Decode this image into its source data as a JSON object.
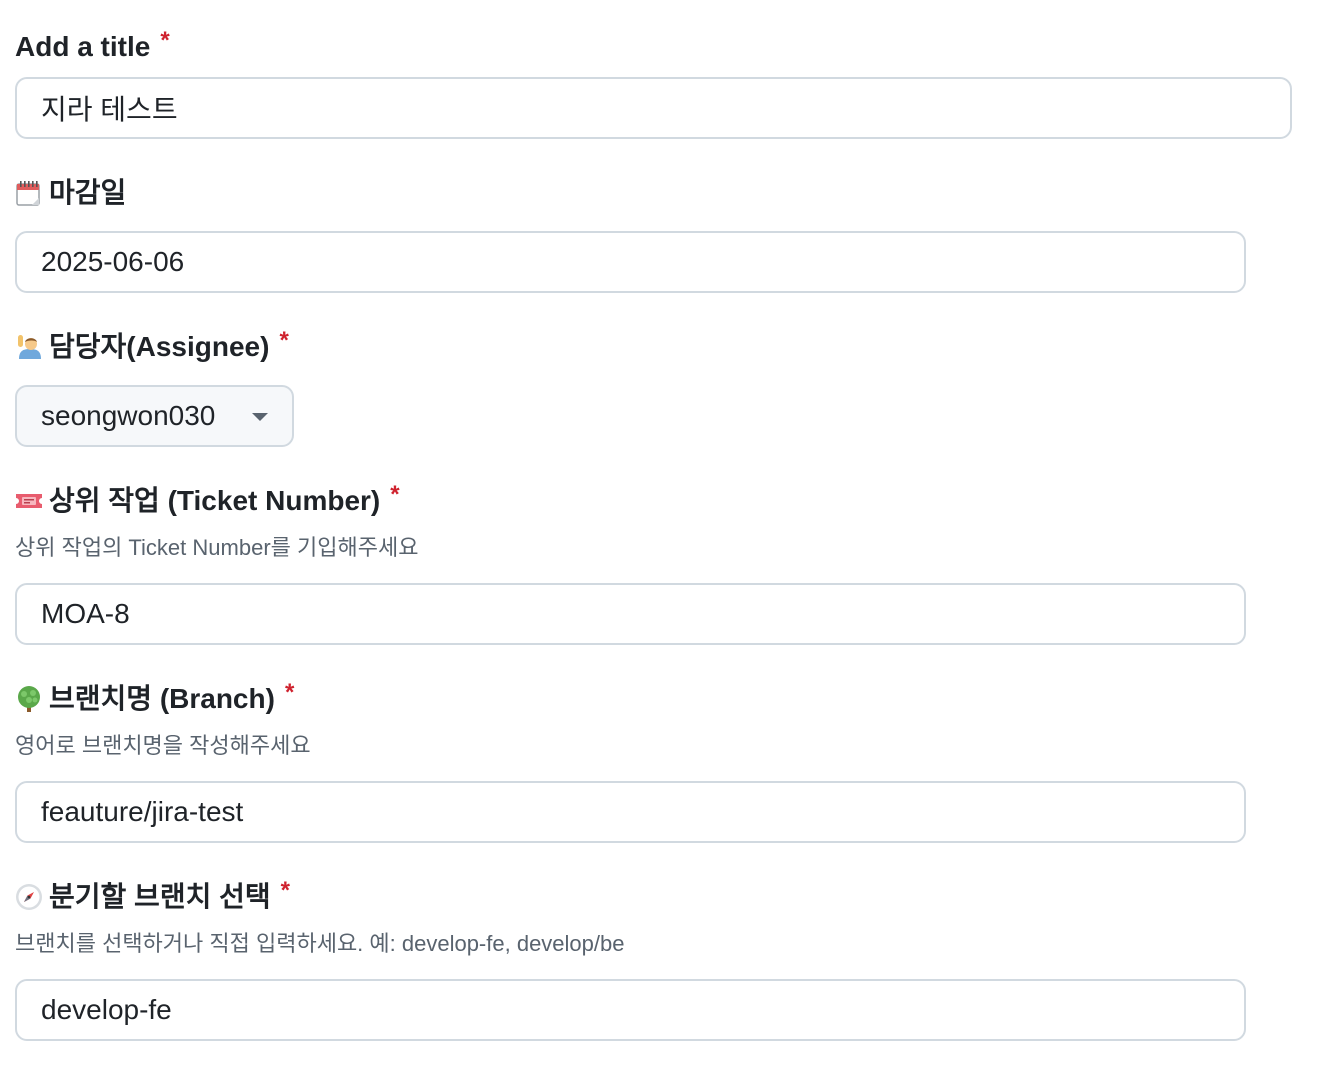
{
  "fields": {
    "title": {
      "label": "Add a title",
      "required_mark": "*",
      "value": "지라 테스트"
    },
    "due_date": {
      "icon": "calendar-icon",
      "label": "마감일",
      "value": "2025-06-06"
    },
    "assignee": {
      "icon": "person-raising-hand-icon",
      "label": "담당자(Assignee)",
      "required_mark": "*",
      "value": "seongwon030"
    },
    "parent_ticket": {
      "icon": "ticket-icon",
      "label": "상위 작업 (Ticket Number)",
      "required_mark": "*",
      "helper": "상위 작업의 Ticket Number를 기입해주세요",
      "value": "MOA-8"
    },
    "branch": {
      "icon": "tree-icon",
      "label": "브랜치명 (Branch)",
      "required_mark": "*",
      "helper": "영어로 브랜치명을 작성해주세요",
      "value": "feauture/jira-test"
    },
    "base_branch": {
      "icon": "compass-icon",
      "label": "분기할 브랜치 선택",
      "required_mark": "*",
      "helper": "브랜치를 선택하거나 직접 입력하세요. 예: develop-fe, develop/be",
      "value": "develop-fe"
    }
  },
  "colors": {
    "required": "#cf222e",
    "border": "#d1d9e0",
    "helper_text": "#59636e",
    "select_bg": "#f6f8fa"
  }
}
